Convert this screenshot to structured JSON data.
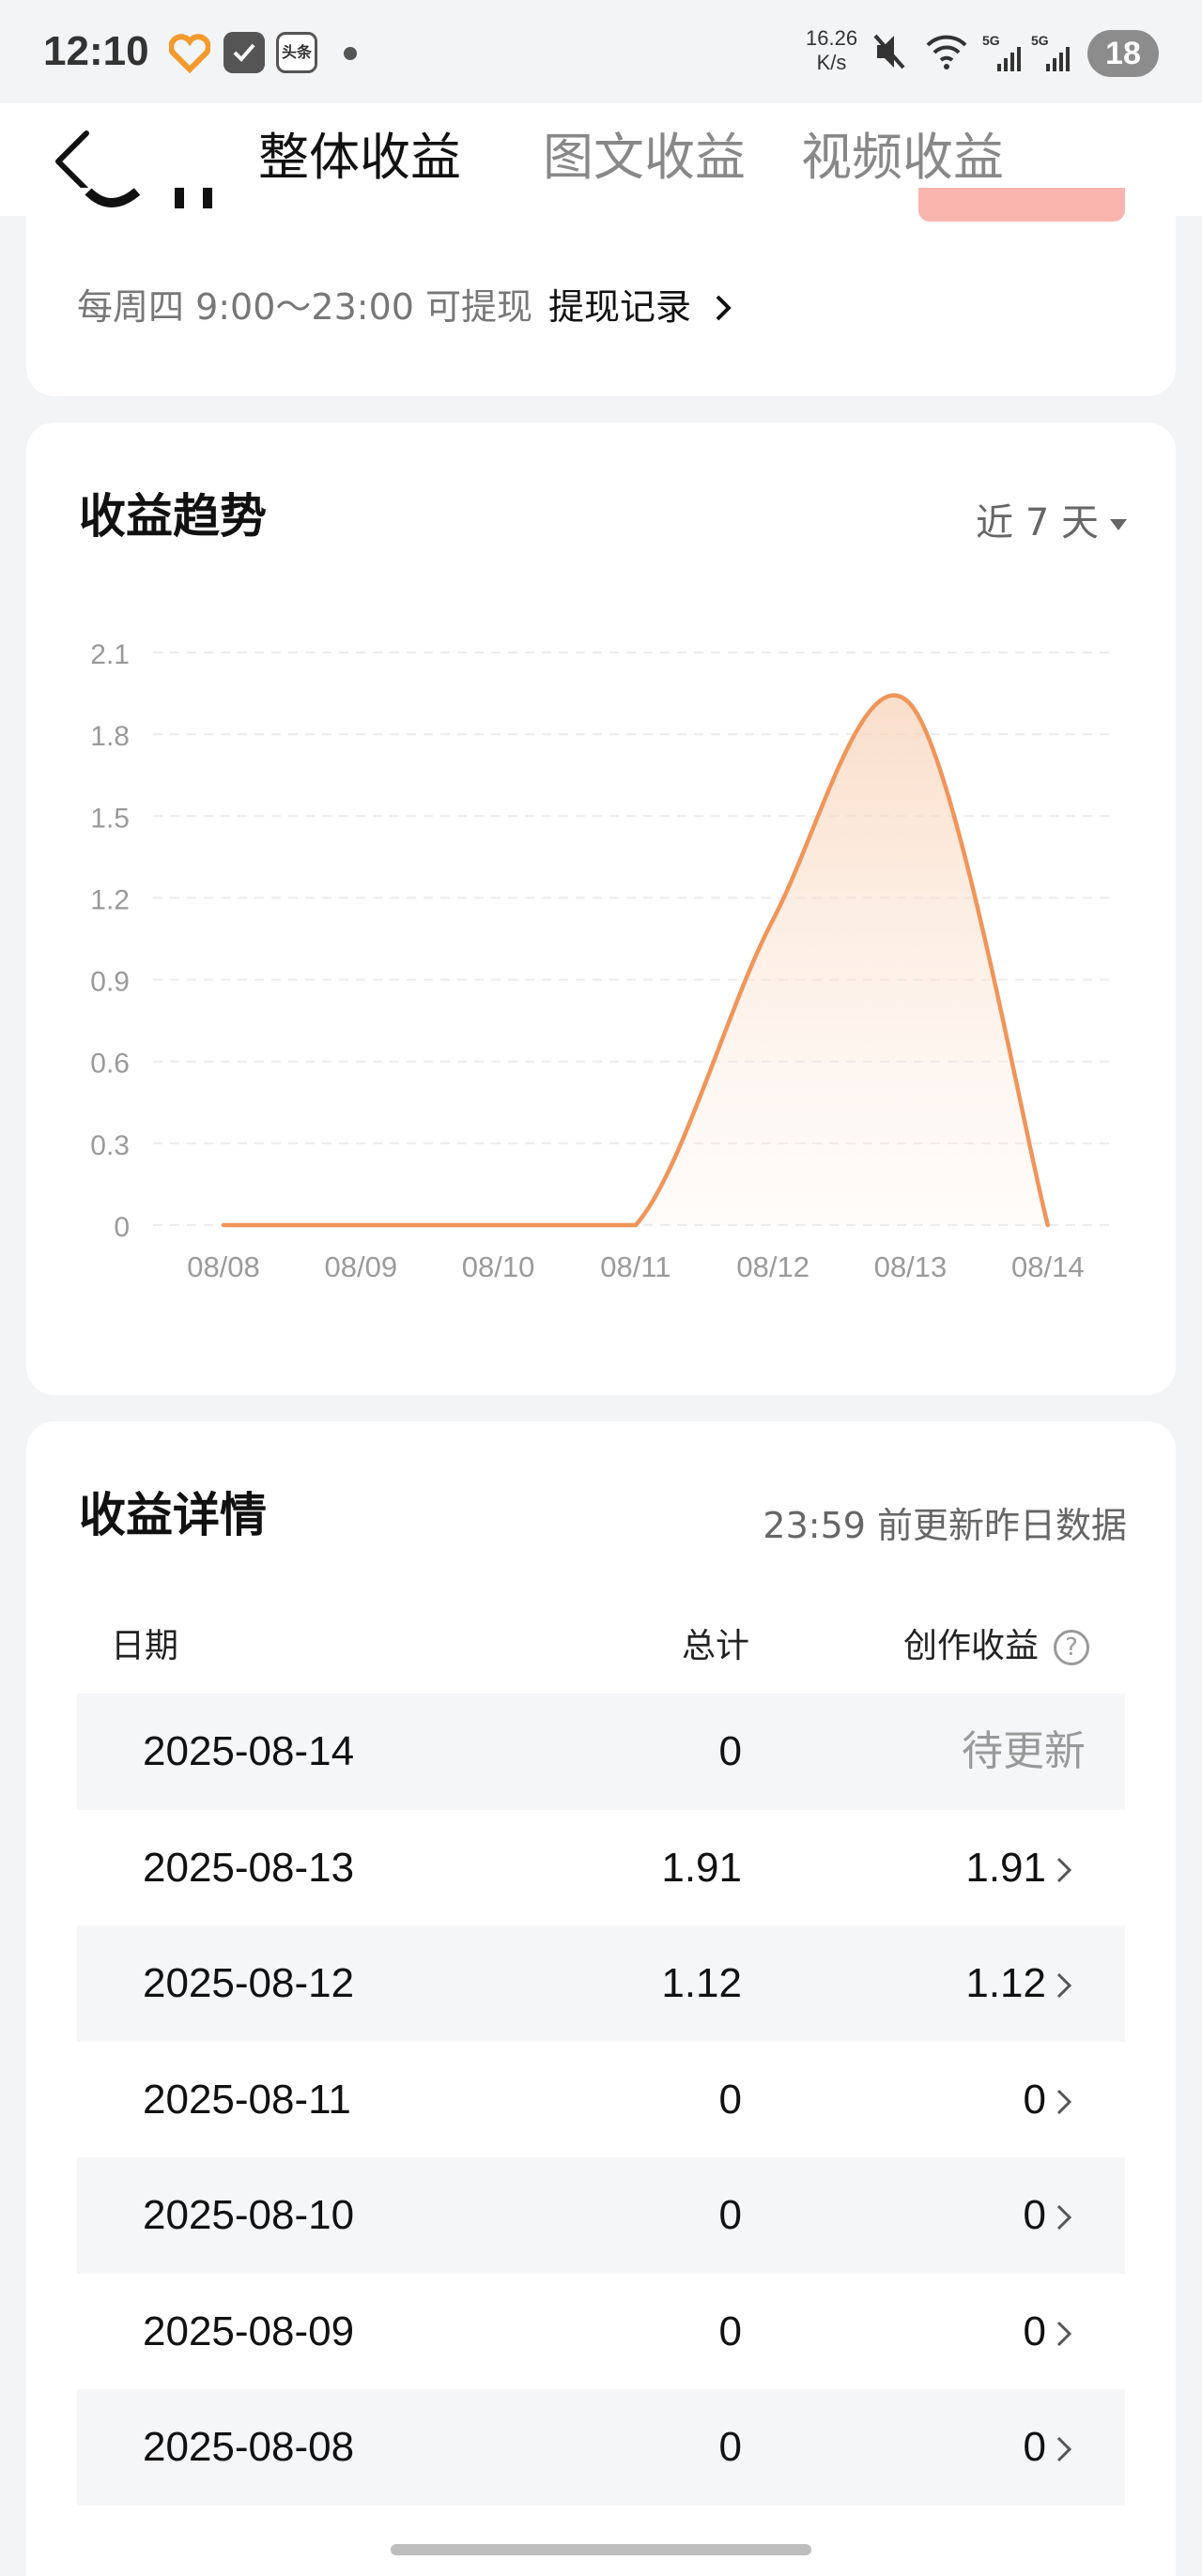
{
  "status_bar": {
    "time": "12:10",
    "app3_label": "头条",
    "net_speed_value": "16.26",
    "net_speed_unit": "K/s",
    "network_1": "5G",
    "network_2": "5G",
    "battery": "18"
  },
  "nav": {
    "tabs": [
      "整体收益",
      "图文收益",
      "视频收益"
    ],
    "active_tab": 0
  },
  "withdraw": {
    "schedule": "每周四 9:00～23:00 可提现",
    "record_link": "提现记录"
  },
  "trend": {
    "title": "收益趋势",
    "range": "近 7 天",
    "accent_color": "#f0955a"
  },
  "chart_data": {
    "type": "area",
    "x": [
      "08/08",
      "08/09",
      "08/10",
      "08/11",
      "08/12",
      "08/13",
      "08/14"
    ],
    "y": [
      0,
      0,
      0,
      0,
      1.12,
      1.91,
      0
    ],
    "y_ticks": [
      "0",
      "0.3",
      "0.6",
      "0.9",
      "1.2",
      "1.5",
      "1.8",
      "2.1"
    ],
    "ylim": [
      0,
      2.1
    ],
    "grid": true,
    "line_color": "#f0955a"
  },
  "detail": {
    "title": "收益详情",
    "update_note": "23:59 前更新昨日数据",
    "headers": {
      "date": "日期",
      "total": "总计",
      "earnings": "创作收益"
    },
    "rows": [
      {
        "date": "2025-08-14",
        "total": "0",
        "earnings": "待更新",
        "pending": true
      },
      {
        "date": "2025-08-13",
        "total": "1.91",
        "earnings": "1.91",
        "pending": false
      },
      {
        "date": "2025-08-12",
        "total": "1.12",
        "earnings": "1.12",
        "pending": false
      },
      {
        "date": "2025-08-11",
        "total": "0",
        "earnings": "0",
        "pending": false
      },
      {
        "date": "2025-08-10",
        "total": "0",
        "earnings": "0",
        "pending": false
      },
      {
        "date": "2025-08-09",
        "total": "0",
        "earnings": "0",
        "pending": false
      },
      {
        "date": "2025-08-08",
        "total": "0",
        "earnings": "0",
        "pending": false
      }
    ]
  }
}
